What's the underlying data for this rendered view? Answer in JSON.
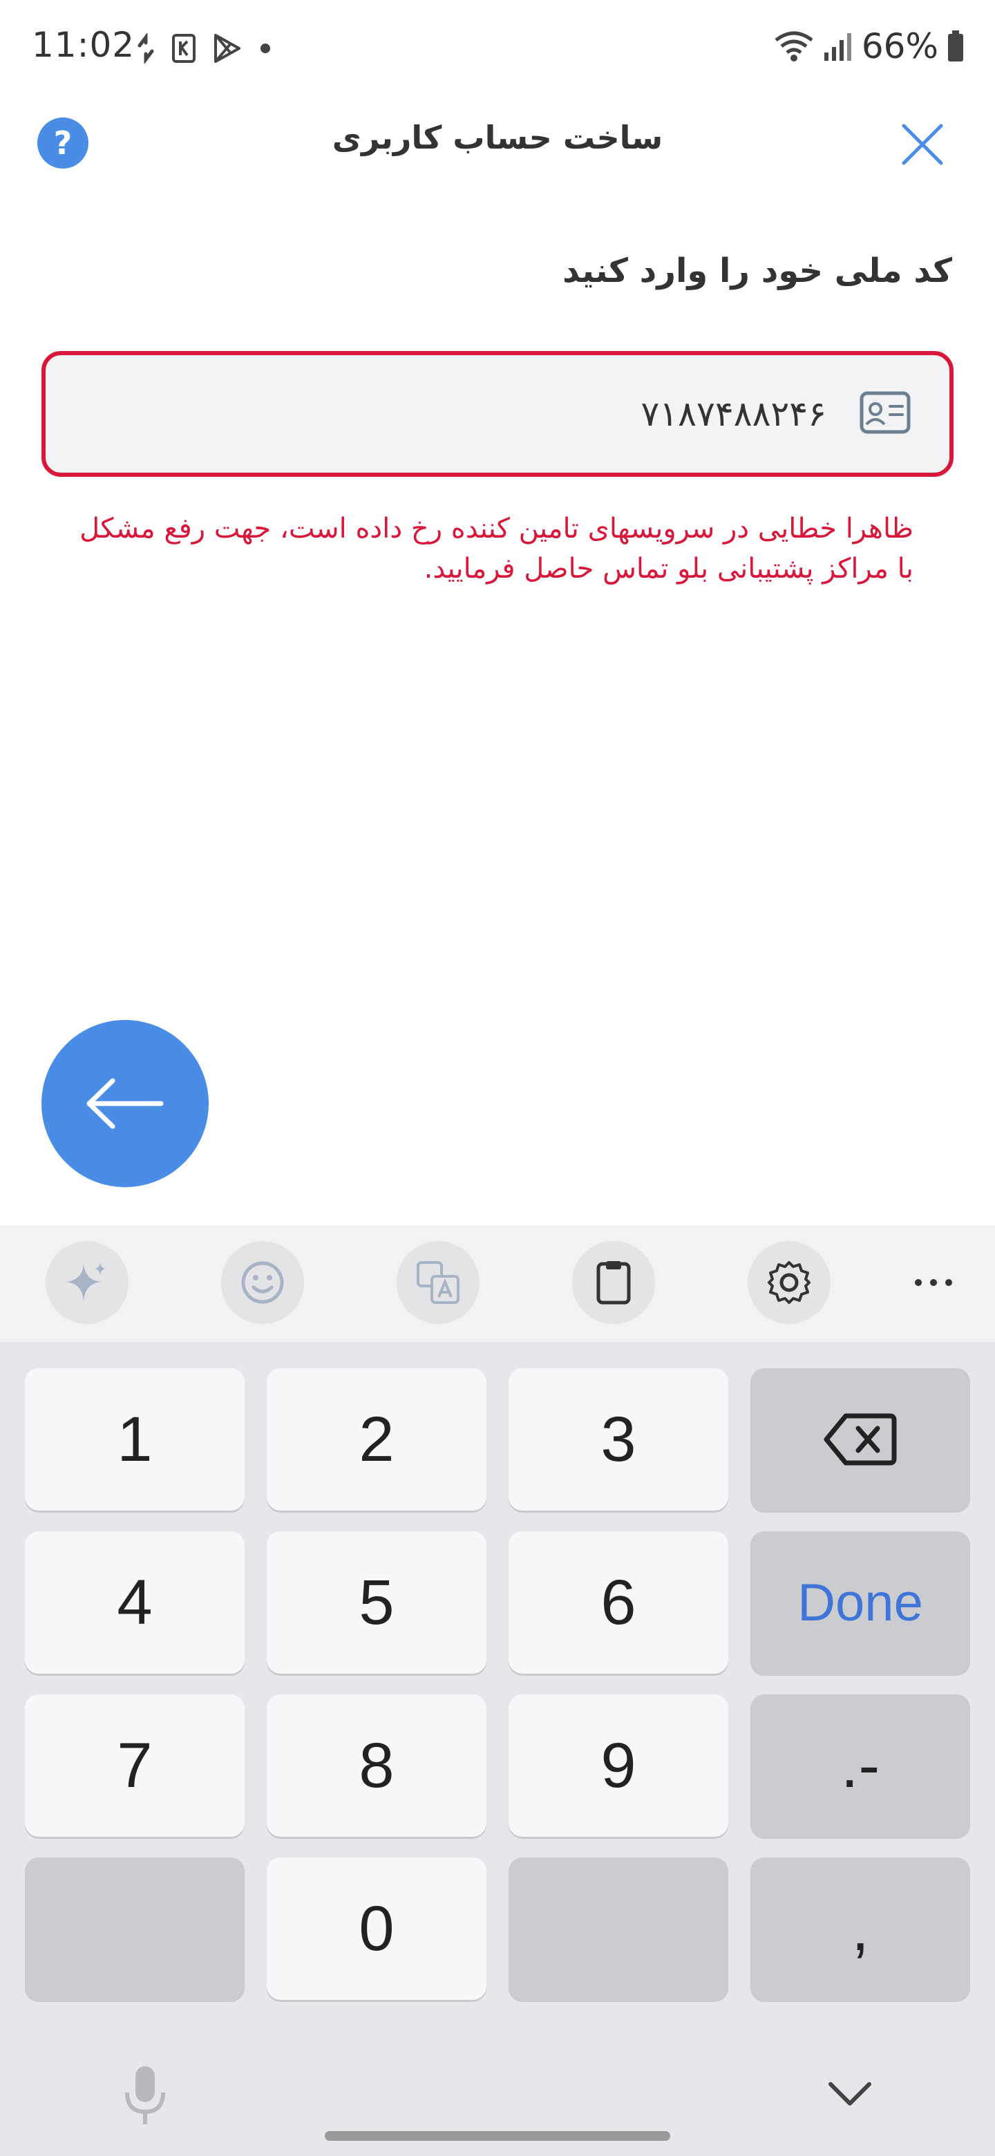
{
  "status_bar": {
    "time": "11:02",
    "battery": "66%",
    "icons": [
      "sync-icon",
      "app-k-icon",
      "play-store-icon",
      "dot-icon",
      "wifi-icon",
      "signal-icon",
      "battery-icon"
    ]
  },
  "header": {
    "title": "ساخت حساب کاربری",
    "help_label": "?",
    "accent_color": "#4a8de6"
  },
  "form": {
    "prompt": "کد ملی خود را وارد کنید",
    "national_id_value": "۷۱۸۷۴۸۸۲۴۶",
    "error_message": "ظاهرا خطایی در سرویسهای تامین کننده رخ داده است، جهت رفع مشکل با مراکز پشتیبانی بلو تماس حاصل فرمایید.",
    "error_color": "#d8173a"
  },
  "keyboard": {
    "toolbar_icons": [
      "sparkle-icon",
      "emoji-icon",
      "translate-icon",
      "clipboard-icon",
      "settings-icon",
      "more-icon"
    ],
    "keys": [
      {
        "label": "1",
        "type": "digit"
      },
      {
        "label": "2",
        "type": "digit"
      },
      {
        "label": "3",
        "type": "digit"
      },
      {
        "label": "",
        "type": "backspace"
      },
      {
        "label": "4",
        "type": "digit"
      },
      {
        "label": "5",
        "type": "digit"
      },
      {
        "label": "6",
        "type": "digit"
      },
      {
        "label": "Done",
        "type": "done"
      },
      {
        "label": "7",
        "type": "digit"
      },
      {
        "label": "8",
        "type": "digit"
      },
      {
        "label": "9",
        "type": "digit"
      },
      {
        "label": ".-",
        "type": "symbol"
      },
      {
        "label": "",
        "type": "blank"
      },
      {
        "label": "0",
        "type": "digit"
      },
      {
        "label": "",
        "type": "blank"
      },
      {
        "label": ",",
        "type": "symbol"
      }
    ]
  }
}
